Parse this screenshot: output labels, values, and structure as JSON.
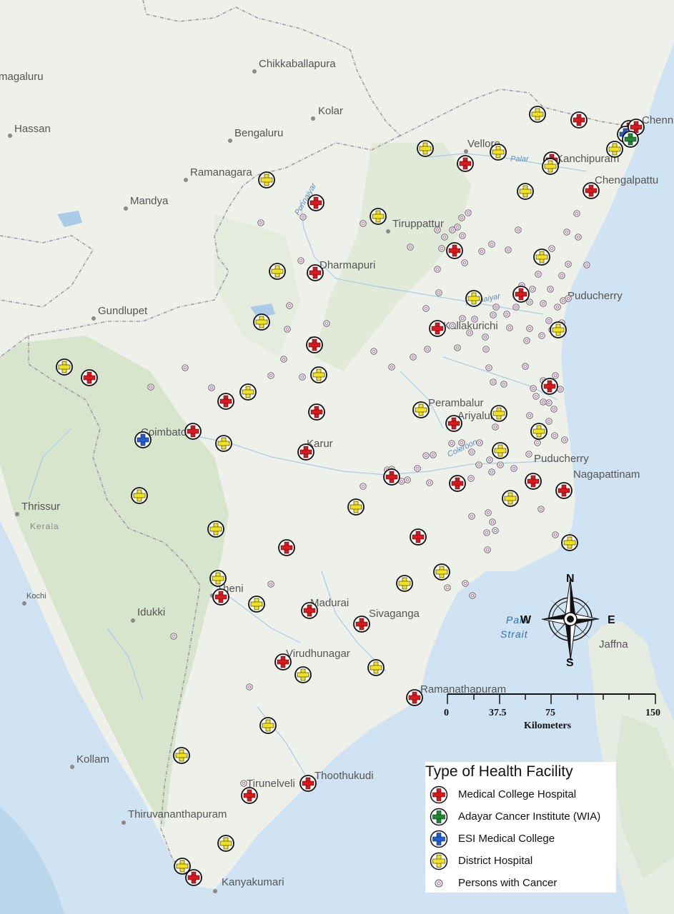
{
  "places": [
    {
      "name": "Chikkaballapura"
    },
    {
      "name": "magaluru"
    },
    {
      "name": "Kolar"
    },
    {
      "name": "Hassan"
    },
    {
      "name": "Bengaluru"
    },
    {
      "name": "Chenn"
    },
    {
      "name": "Vellore"
    },
    {
      "name": "Kanchipuram"
    },
    {
      "name": "Ramanagara"
    },
    {
      "name": "Chengalpattu"
    },
    {
      "name": "Mandya"
    },
    {
      "name": "Tiruppattur"
    },
    {
      "name": "Dharmapuri"
    },
    {
      "name": "Puducherry"
    },
    {
      "name": "Gundlupet"
    },
    {
      "name": "Kallakurichi"
    },
    {
      "name": "Perambalur"
    },
    {
      "name": "Ariyalur"
    },
    {
      "name": "Coimbatore"
    },
    {
      "name": "Karur"
    },
    {
      "name": "Puducherry"
    },
    {
      "name": "Nagapattinam"
    },
    {
      "name": "Thrissur"
    },
    {
      "name": "Kerala"
    },
    {
      "name": "Kochi"
    },
    {
      "name": "Theni"
    },
    {
      "name": "Madurai"
    },
    {
      "name": "Sivaganga"
    },
    {
      "name": "Idukki"
    },
    {
      "name": "Jaffna"
    },
    {
      "name": "Virudhunagar"
    },
    {
      "name": "Ramanathapuram"
    },
    {
      "name": "Kollam"
    },
    {
      "name": "Thoothukudi"
    },
    {
      "name": "Tirunelveli"
    },
    {
      "name": "Thiruvananthapuram"
    },
    {
      "name": "Kanyakumari"
    }
  ],
  "rivers": [
    "Palar",
    "Ponnaiyar",
    "Ponnaiyar",
    "Coleroon"
  ],
  "strait": [
    "Palk",
    "Strait"
  ],
  "legend": {
    "title": "Type of Health Facility",
    "items": [
      {
        "key": "mch",
        "label": "Medical College Hospital",
        "color": "#e0161b"
      },
      {
        "key": "aci",
        "label": "Adayar Cancer Institute (WIA)",
        "color": "#1e8a2e"
      },
      {
        "key": "esi",
        "label": "ESI Medical College",
        "color": "#1f5fd6"
      },
      {
        "key": "dh",
        "label": "District Hospital",
        "color": "#f2e21b"
      },
      {
        "key": "pwc",
        "label": "Persons with Cancer",
        "color": "#c0509a"
      }
    ]
  },
  "scale_bar": {
    "ticks": [
      "0",
      "37.5",
      "75",
      "150"
    ],
    "unit": "Kilometers"
  },
  "compass": {
    "n": "N",
    "s": "S",
    "e": "E",
    "w": "W"
  },
  "colors": {
    "sea": "#cfe3f2",
    "land": "#eef0ea",
    "hills": "#cfe0c6",
    "rivers": "#a9cbe8",
    "borders": "#a39ba8"
  }
}
